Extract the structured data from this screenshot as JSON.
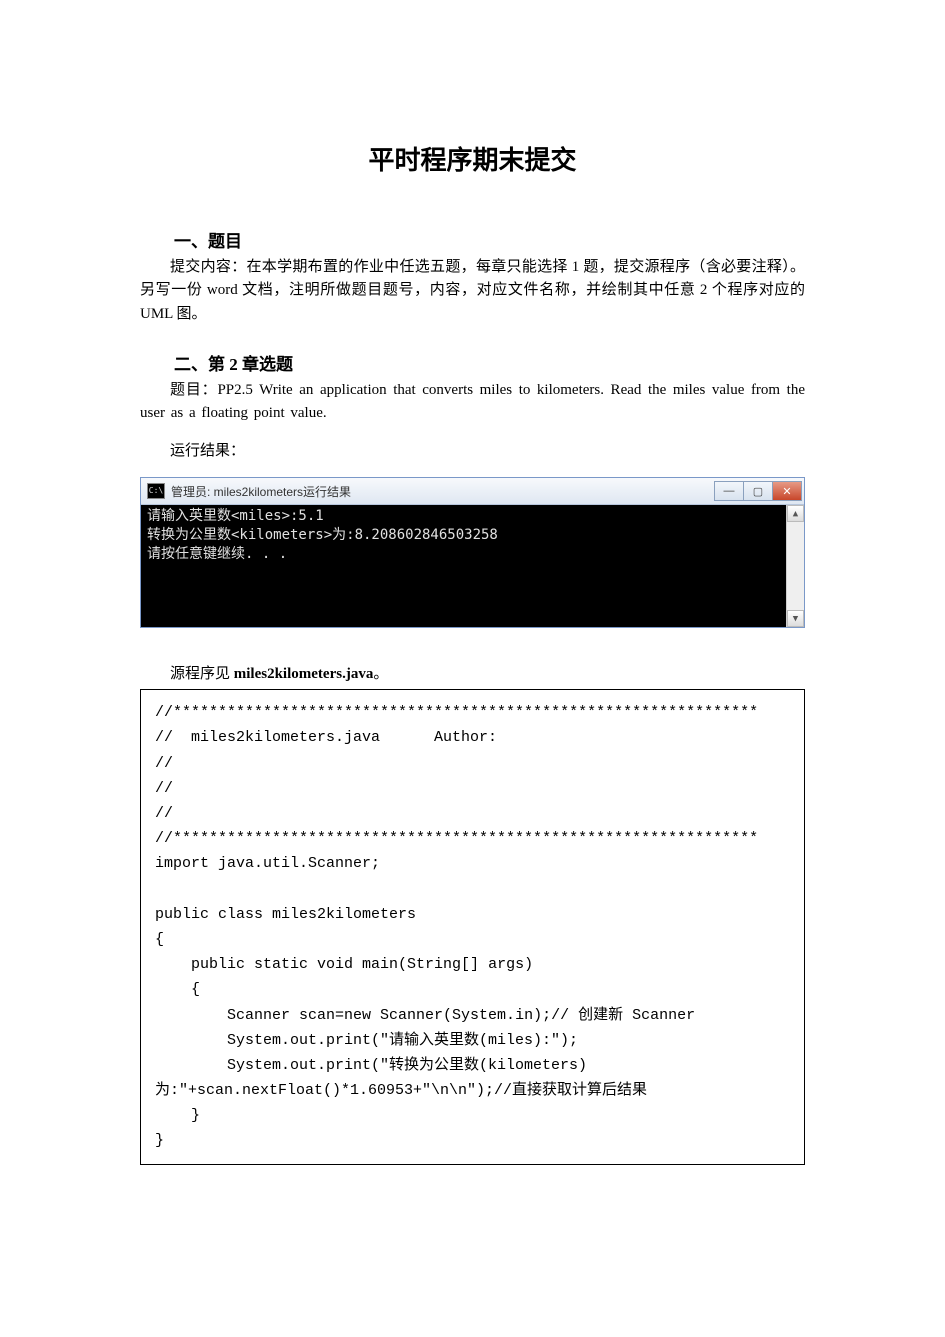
{
  "title": "平时程序期末提交",
  "section1": {
    "head": "一、题目",
    "text": "提交内容：在本学期布置的作业中任选五题，每章只能选择 1 题，提交源程序（含必要注释）。另写一份 word 文档，注明所做题目题号，内容，对应文件名称，并绘制其中任意 2 个程序对应的 UML 图。"
  },
  "section2": {
    "head": "二、第 2 章选题",
    "problem": "题目：PP2.5  Write  an  application  that  converts  miles  to  kilometers.  Read  the  miles  value from  the  user  as  a  floating  point  value.",
    "run_label": "运行结果：",
    "src_label_prefix": "源程序见 ",
    "src_filename": "miles2kilometers.java",
    "src_label_suffix": "。"
  },
  "terminal": {
    "title": "管理员:  miles2kilometers运行结果",
    "line1": "请输入英里数<miles>:5.1",
    "line2": "转换为公里数<kilometers>为:8.208602846503258",
    "line3": "",
    "line4": "请按任意键继续. . ."
  },
  "win_buttons": {
    "min": "—",
    "max": "▢",
    "close": "✕"
  },
  "scroll": {
    "up": "▲",
    "down": "▼"
  },
  "code": "//*****************************************************************\n//  miles2kilometers.java      Author:\n//\n//\n//\n//*****************************************************************\nimport java.util.Scanner;\n\npublic class miles2kilometers\n{\n    public static void main(String[] args)\n    {\n        Scanner scan=new Scanner(System.in);// 创建新 Scanner\n        System.out.print(\"请输入英里数(miles):\");\n        System.out.print(\"转换为公里数(kilometers)\n为:\"+scan.nextFloat()*1.60953+\"\\n\\n\");//直接获取计算后结果\n    }\n}"
}
